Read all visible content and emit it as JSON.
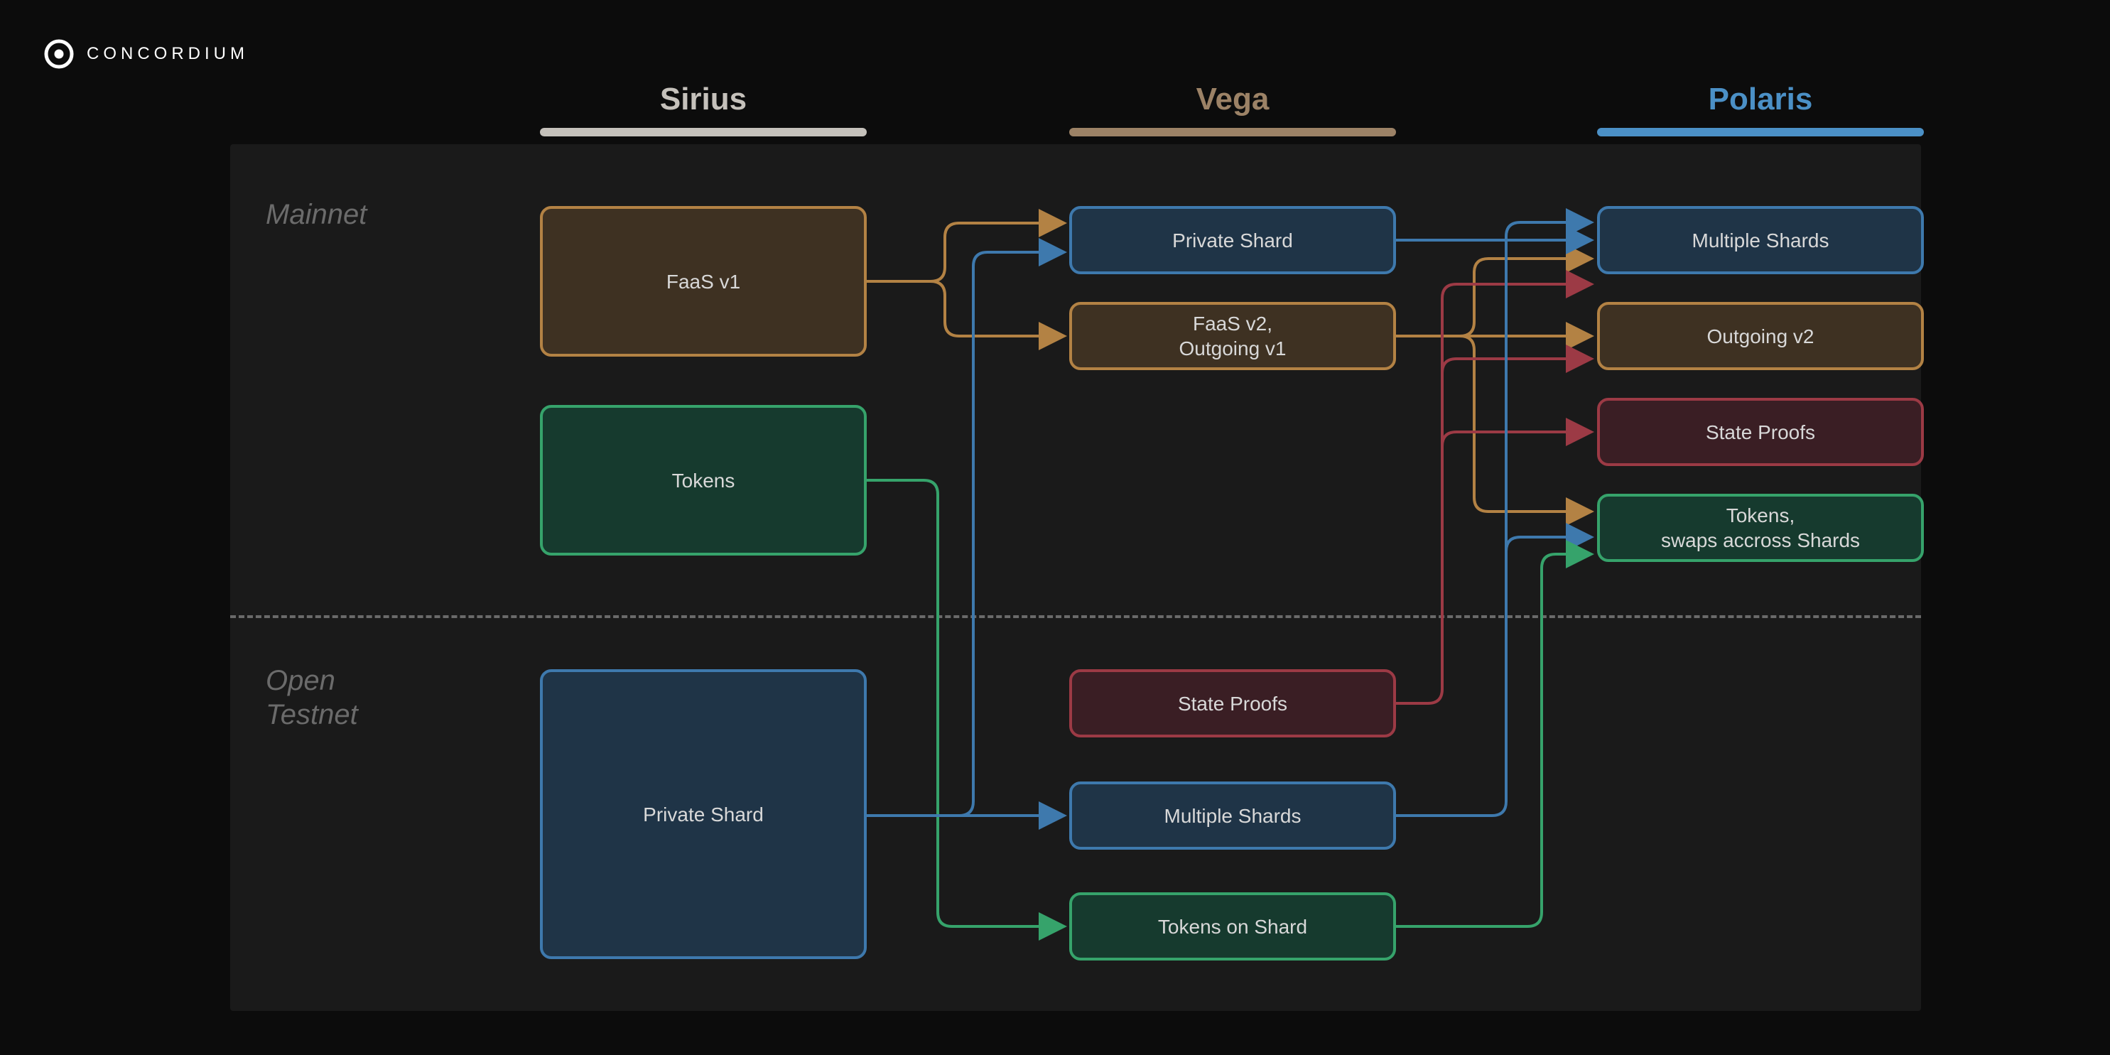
{
  "brand": "CONCORDIUM",
  "columns": {
    "c1": {
      "label": "Sirius",
      "color": "#c5c1bb"
    },
    "c2": {
      "label": "Vega",
      "color": "#9c8266"
    },
    "c3": {
      "label": "Polaris",
      "color": "#4b90c6"
    }
  },
  "sections": {
    "mainnet": "Mainnet",
    "open_testnet_l1": "Open",
    "open_testnet_l2": "Testnet"
  },
  "boxes": {
    "faas_v1": "FaaS v1",
    "tokens": "Tokens",
    "private_shard_m": "Private Shard",
    "faas_v2": "FaaS v2,\nOutgoing v1",
    "multiple_shards_m": "Multiple Shards",
    "outgoing_v2": "Outgoing v2",
    "state_proofs_m": "State Proofs",
    "tokens_swaps": "Tokens,\nswaps accross Shards",
    "state_proofs_t": "State Proofs",
    "private_shard_t": "Private Shard",
    "multiple_shards_t": "Multiple Shards",
    "tokens_on_shard": "Tokens on Shard"
  },
  "colors": {
    "orange_border": "#b38244",
    "orange_bg": "#3e3122",
    "blue_border": "#3e79ad",
    "blue_bg": "#1f3447",
    "green_border": "#36a36b",
    "green_bg": "#163a2e",
    "red_border": "#9c3a45",
    "red_bg": "#3a1e24"
  }
}
